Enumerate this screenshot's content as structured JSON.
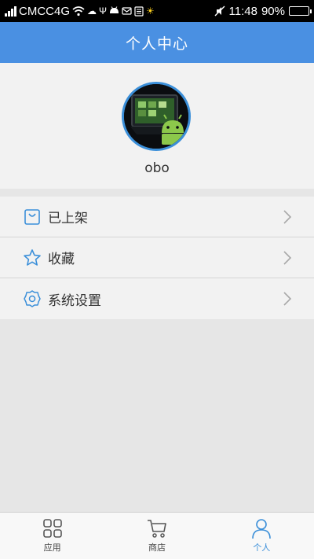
{
  "status_bar": {
    "carrier": "CMCC4G",
    "time": "11:48",
    "battery": "90%",
    "battery_level": 0.9,
    "icons": [
      "signal-icon",
      "wifi-icon",
      "cloud-icon",
      "usb-icon",
      "android-icon",
      "mail-icon",
      "sim-icon",
      "brightness-icon",
      "mute-icon",
      "battery-icon"
    ]
  },
  "header": {
    "title": "个人中心"
  },
  "profile": {
    "username": "obo",
    "avatar_icon": "avatar-image"
  },
  "menu": {
    "items": [
      {
        "label": "已上架",
        "icon": "bag-icon"
      },
      {
        "label": "收藏",
        "icon": "star-icon"
      },
      {
        "label": "系统设置",
        "icon": "settings-icon"
      }
    ]
  },
  "bottom_nav": {
    "items": [
      {
        "label": "应用",
        "icon": "apps-icon",
        "active": false
      },
      {
        "label": "商店",
        "icon": "cart-icon",
        "active": false
      },
      {
        "label": "个人",
        "icon": "person-icon",
        "active": true
      }
    ]
  },
  "colors": {
    "accent": "#4a90e2",
    "icon_blue": "#3b8fd9",
    "background": "#e6e6e6",
    "surface": "#f2f2f2"
  }
}
